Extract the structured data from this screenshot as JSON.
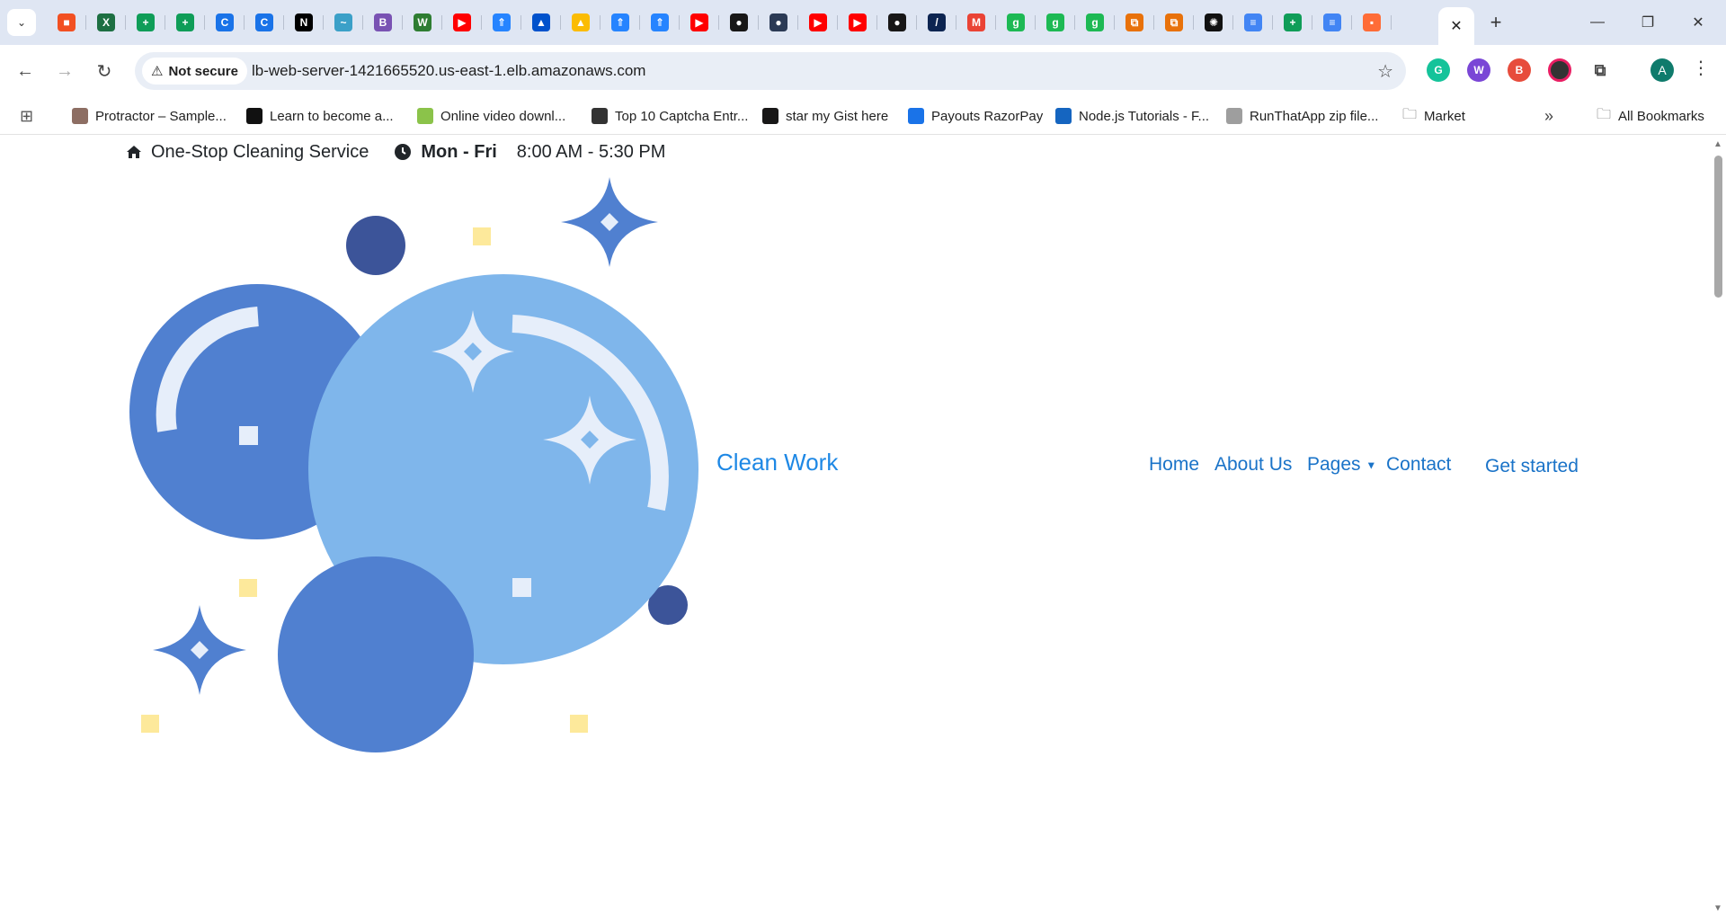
{
  "browser": {
    "tab_icons": [
      {
        "name": "microsoft-icon",
        "color": "#f25022",
        "glyph": "■"
      },
      {
        "name": "excel-icon",
        "color": "#1d6f42",
        "glyph": "X"
      },
      {
        "name": "sheets-icon",
        "color": "#0f9d58",
        "glyph": "+"
      },
      {
        "name": "sheets-icon",
        "color": "#0f9d58",
        "glyph": "+"
      },
      {
        "name": "c-icon",
        "color": "#1a73e8",
        "glyph": "C"
      },
      {
        "name": "c-icon",
        "color": "#1a73e8",
        "glyph": "C"
      },
      {
        "name": "notion-icon",
        "color": "#000000",
        "glyph": "N"
      },
      {
        "name": "bird-icon",
        "color": "#3ba0c8",
        "glyph": "~"
      },
      {
        "name": "bootstrap-icon",
        "color": "#7952b3",
        "glyph": "B"
      },
      {
        "name": "w-icon",
        "color": "#2e7d32",
        "glyph": "W"
      },
      {
        "name": "youtube-icon",
        "color": "#ff0000",
        "glyph": "▶"
      },
      {
        "name": "jira-icon",
        "color": "#2684ff",
        "glyph": "⇑"
      },
      {
        "name": "atlassian-icon",
        "color": "#0052cc",
        "glyph": "▲"
      },
      {
        "name": "drive-icon",
        "color": "#fbbc04",
        "glyph": "▲"
      },
      {
        "name": "jira-icon",
        "color": "#2684ff",
        "glyph": "⇑"
      },
      {
        "name": "jira-icon",
        "color": "#2684ff",
        "glyph": "⇑"
      },
      {
        "name": "youtube-icon",
        "color": "#ff0000",
        "glyph": "▶"
      },
      {
        "name": "github-icon",
        "color": "#181717",
        "glyph": "●"
      },
      {
        "name": "app-icon",
        "color": "#2b3a55",
        "glyph": "●"
      },
      {
        "name": "youtube-icon",
        "color": "#ff0000",
        "glyph": "▶"
      },
      {
        "name": "youtube-icon",
        "color": "#ff0000",
        "glyph": "▶"
      },
      {
        "name": "github-icon",
        "color": "#181717",
        "glyph": "●"
      },
      {
        "name": "razorpay-icon",
        "color": "#0c2451",
        "glyph": "/"
      },
      {
        "name": "gmail-icon",
        "color": "#ea4335",
        "glyph": "M"
      },
      {
        "name": "g-icon",
        "color": "#1db954",
        "glyph": "g"
      },
      {
        "name": "g-icon",
        "color": "#1db954",
        "glyph": "g"
      },
      {
        "name": "g-icon",
        "color": "#1db954",
        "glyph": "g"
      },
      {
        "name": "orange-icon",
        "color": "#e8710a",
        "glyph": "⧉"
      },
      {
        "name": "orange-icon",
        "color": "#e8710a",
        "glyph": "⧉"
      },
      {
        "name": "openai-icon",
        "color": "#111111",
        "glyph": "✺"
      },
      {
        "name": "docs-icon",
        "color": "#4285f4",
        "glyph": "≡"
      },
      {
        "name": "sheets-icon",
        "color": "#0f9d58",
        "glyph": "+"
      },
      {
        "name": "docs-icon",
        "color": "#4285f4",
        "glyph": "≡"
      },
      {
        "name": "postman-icon",
        "color": "#ff6c37",
        "glyph": "▪"
      }
    ],
    "active_tab_icon": "github-icon",
    "security_label": "Not secure",
    "url": "lb-web-server-1421665520.us-east-1.elb.amazonaws.com",
    "profile_initial": "A",
    "bookmarks": [
      {
        "label": "Protractor – Sample...",
        "color": "#8d6e63"
      },
      {
        "label": "Learn to become a...",
        "color": "#111111"
      },
      {
        "label": "Online video downl...",
        "color": "#8bc34a"
      },
      {
        "label": "Top 10 Captcha Entr...",
        "color": "#333333"
      },
      {
        "label": "star my Gist here",
        "color": "#181717"
      },
      {
        "label": "Payouts RazorPay",
        "color": "#1a73e8"
      },
      {
        "label": "Node.js Tutorials - F...",
        "color": "#1565c0"
      },
      {
        "label": "RunThatApp zip file...",
        "color": "#9e9e9e"
      },
      {
        "label": "Market",
        "color": "folder"
      }
    ],
    "bookmarks_overflow": "»",
    "all_bookmarks_label": "All Bookmarks"
  },
  "site": {
    "topbar": {
      "tagline": "One-Stop Cleaning Service",
      "hours_days": "Mon - Fri",
      "hours_time": "8:00 AM - 5:30 PM"
    },
    "brand": "Clean Work",
    "nav": {
      "home": "Home",
      "about": "About Us",
      "pages": "Pages",
      "contact": "Contact",
      "cta": "Get started"
    },
    "colors": {
      "primary_blue": "#1a73c8",
      "bubble_dark": "#5080d0",
      "bubble_light": "#7fb6eb",
      "navy_dot": "#3c5499",
      "yellow_square": "#fde99b"
    }
  }
}
